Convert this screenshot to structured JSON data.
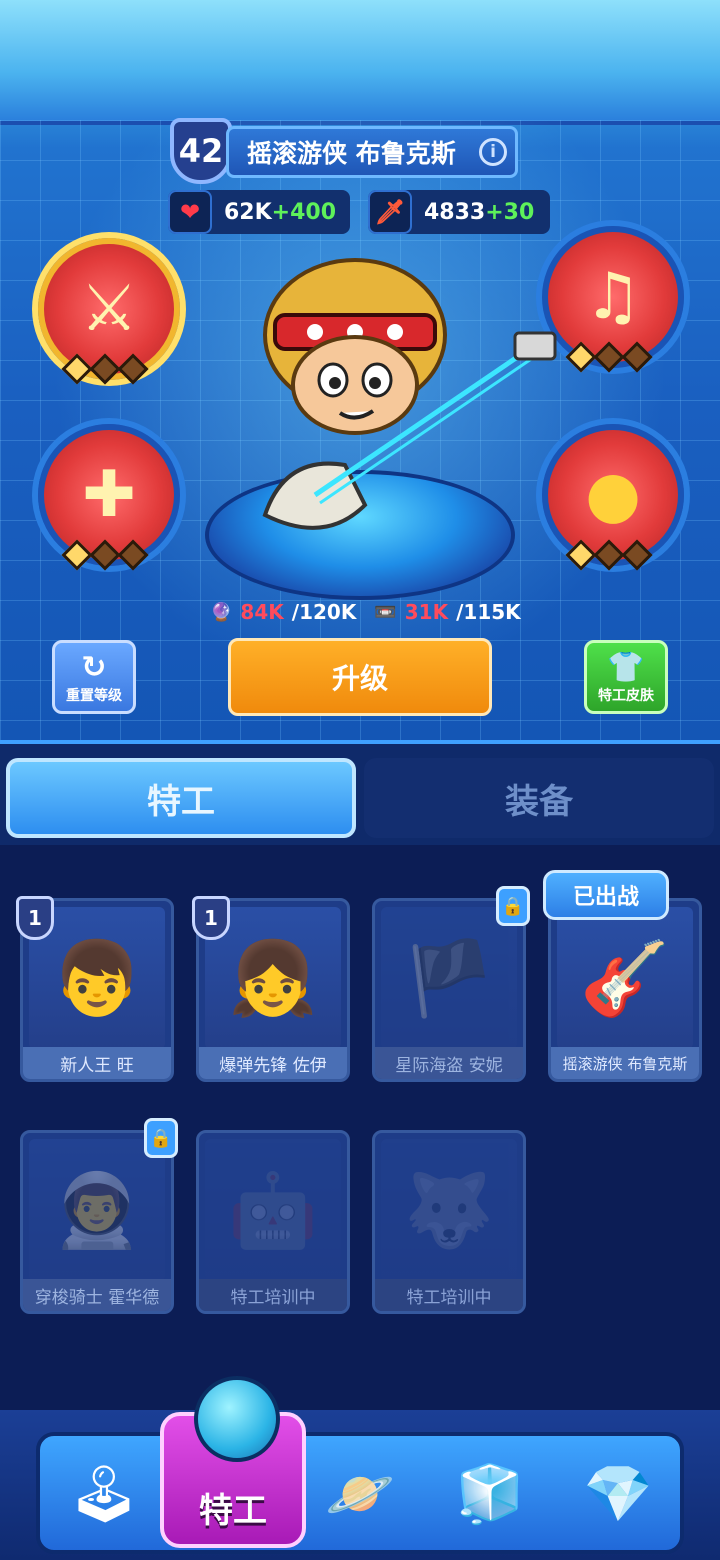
{
  "hero": {
    "level": "42",
    "name": "摇滚游侠 布鲁克斯",
    "hp": {
      "value": "62K",
      "bonus": "+400"
    },
    "attack": {
      "value": "4833",
      "bonus": "+30"
    },
    "exp": {
      "current": "84K",
      "max": "/120K"
    },
    "tapes": {
      "current": "31K",
      "max": "/115K"
    }
  },
  "skills": [
    {
      "icon": "sword-skill-icon",
      "glyph": "⚔",
      "rank": 1
    },
    {
      "icon": "music-note-skill-icon",
      "glyph": "♫",
      "rank": 1
    },
    {
      "icon": "crystal-skill-icon",
      "glyph": "✚",
      "rank": 1
    },
    {
      "icon": "gold-orb-skill-icon",
      "glyph": "●",
      "rank": 1
    }
  ],
  "buttons": {
    "reset": "重置等级",
    "upgrade": "升级",
    "skin": "特工皮肤"
  },
  "tabs": {
    "agents": "特工",
    "equipment": "装备"
  },
  "agents": [
    {
      "name": "新人王 旺",
      "level": "1",
      "state": "owned",
      "glyph": "👦"
    },
    {
      "name": "爆弹先锋 佐伊",
      "level": "1",
      "state": "owned",
      "glyph": "👧"
    },
    {
      "name": "星际海盗 安妮",
      "level": "",
      "state": "locked",
      "glyph": "🏴"
    },
    {
      "name": "摇滚游侠 布鲁克斯",
      "level": "",
      "state": "deployed",
      "glyph": "🎸"
    },
    {
      "name": "穿梭骑士 霍华德",
      "level": "",
      "state": "locked",
      "glyph": "👨‍🚀"
    },
    {
      "name": "特工培训中",
      "level": "",
      "state": "training",
      "glyph": "🤖"
    },
    {
      "name": "特工培训中",
      "level": "",
      "state": "training",
      "glyph": "🐺"
    }
  ],
  "deployed_badge": "已出战",
  "nav": {
    "active_label": "特工",
    "items": [
      "arcade-machine-icon",
      "agent-helmet-icon",
      "planet-icon",
      "cube-icon",
      "gem-frame-icon"
    ]
  }
}
